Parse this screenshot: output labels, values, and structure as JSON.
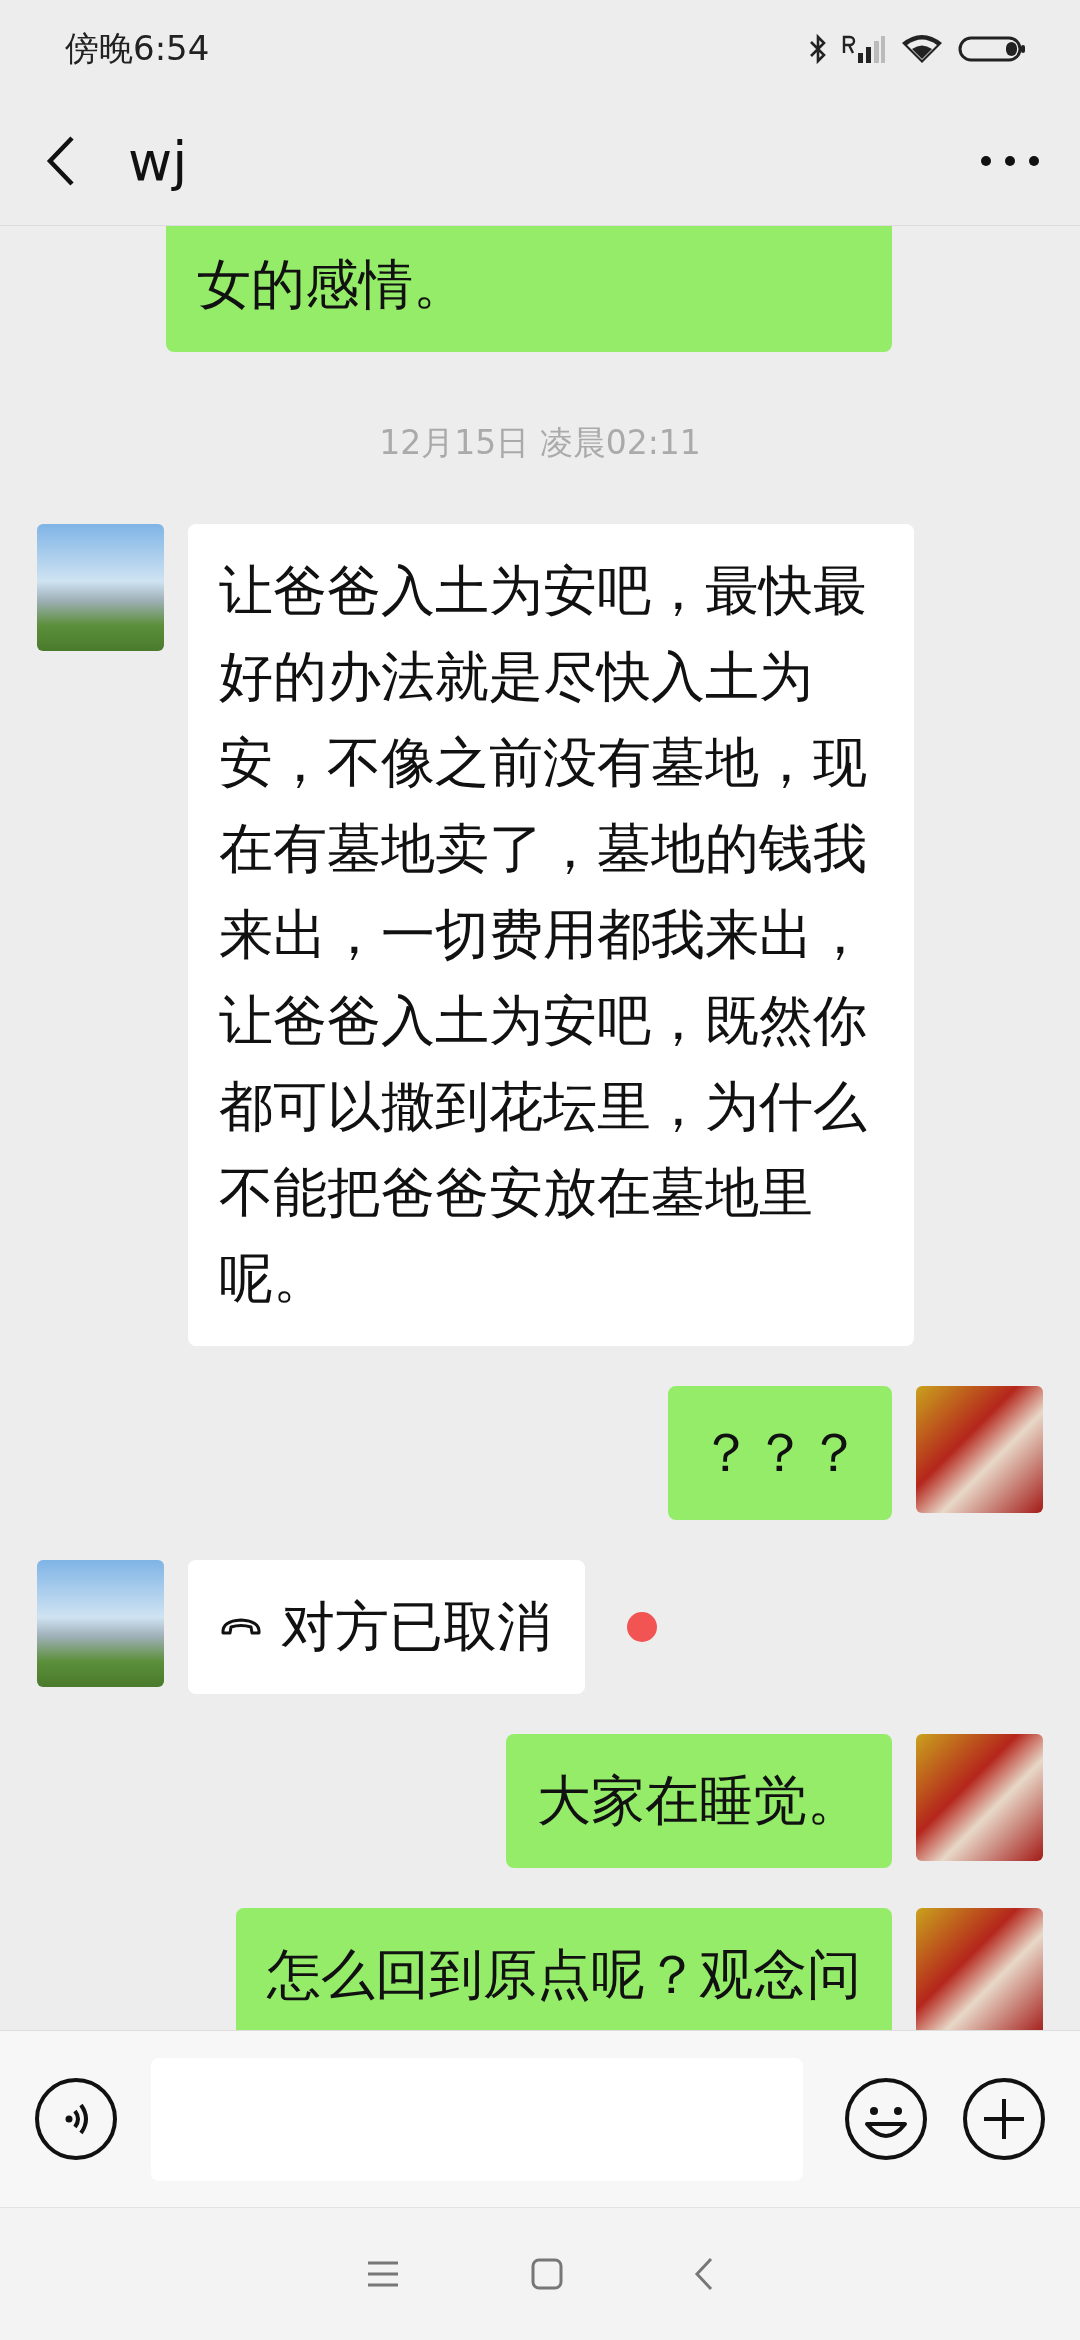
{
  "status_bar": {
    "time": "傍晚6:54"
  },
  "header": {
    "title": "wj"
  },
  "messages": [
    {
      "kind": "partial",
      "outgoing": true,
      "text": "女的感情。"
    },
    {
      "kind": "time",
      "text": "12月15日 凌晨02:11"
    },
    {
      "kind": "text",
      "outgoing": false,
      "text": "让爸爸入土为安吧，最快最好的办法就是尽快入土为安，不像之前没有墓地，现在有墓地卖了，墓地的钱我来出，一切费用都我来出，让爸爸入土为安吧，既然你都可以撒到花坛里，为什么不能把爸爸安放在墓地里呢。"
    },
    {
      "kind": "text",
      "outgoing": true,
      "text": "？？？"
    },
    {
      "kind": "call",
      "outgoing": false,
      "text": "对方已取消",
      "unread": true
    },
    {
      "kind": "text",
      "outgoing": true,
      "text": "大家在睡觉。"
    },
    {
      "kind": "text",
      "outgoing": true,
      "text": "怎么回到原点呢？观念问"
    }
  ]
}
